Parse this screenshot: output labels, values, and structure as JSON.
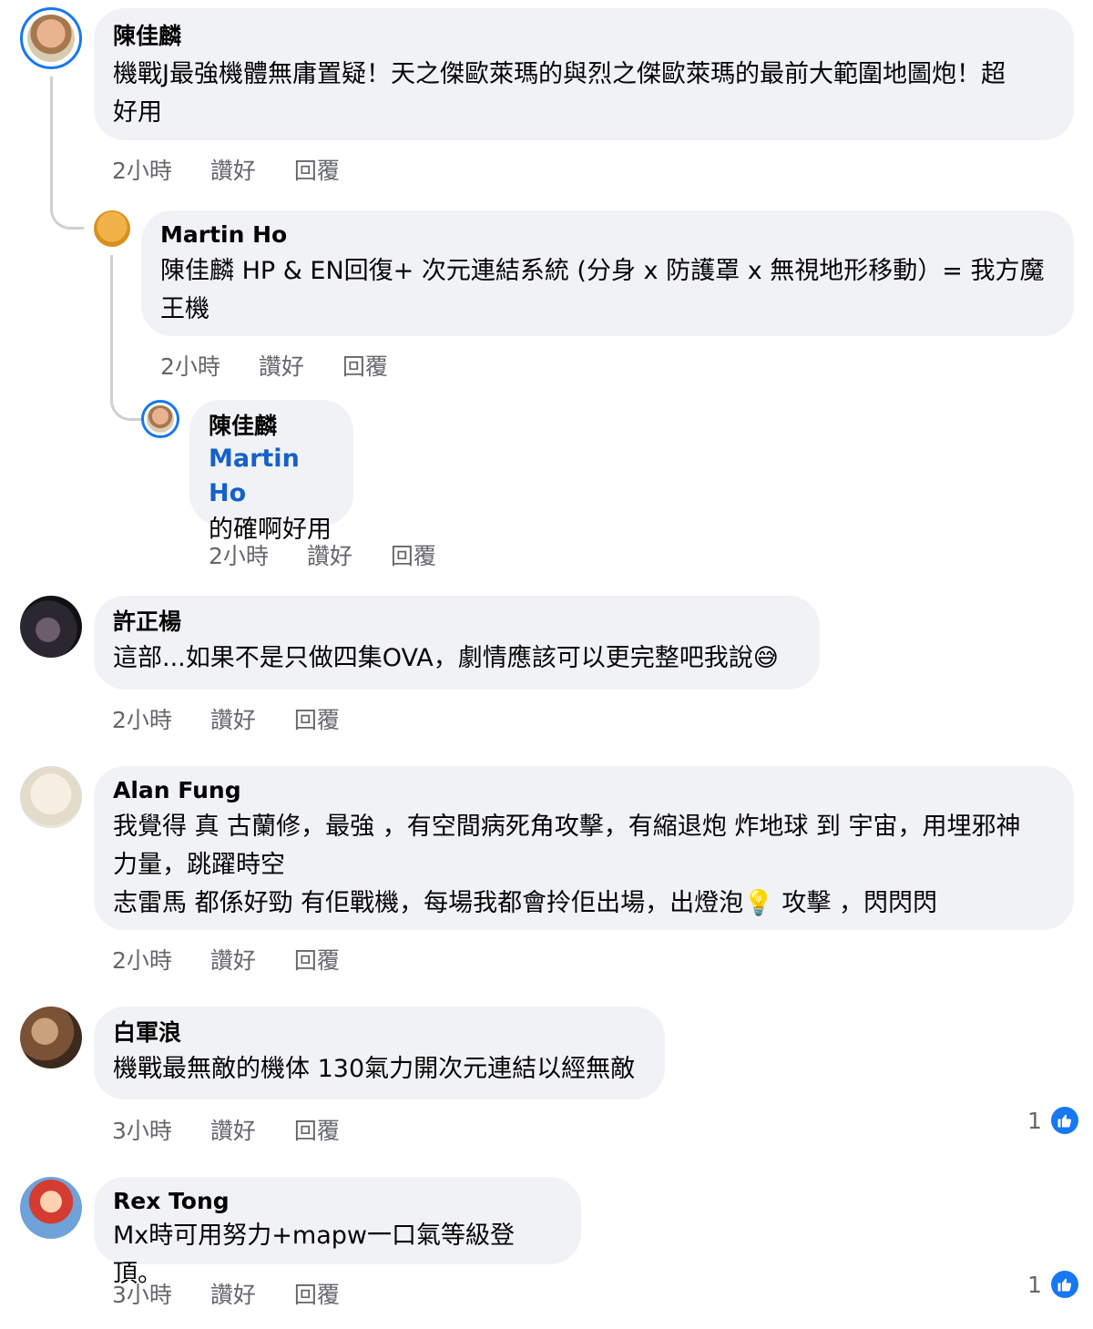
{
  "comments": [
    {
      "author": "陳佳麟",
      "text": "機戰J最強機體無庸置疑！天之傑歐萊瑪的與烈之傑歐萊瑪的最前大範圍地圖炮！超\n好用",
      "time": "2小時",
      "like": "讚好",
      "reply": "回覆"
    },
    {
      "author": "Martin Ho",
      "text": "陳佳麟 HP & EN回復+ 次元連結系統 (分身 x 防護罩 x 無視地形移動）= 我方魔\n王機",
      "time": "2小時",
      "like": "讚好",
      "reply": "回覆"
    },
    {
      "author": "陳佳麟",
      "mention": "Martin Ho",
      "text": "的確啊好用",
      "time": "2小時",
      "like": "讚好",
      "reply": "回覆"
    },
    {
      "author": "許正楊",
      "text": "這部...如果不是只做四集OVA，劇情應該可以更完整吧我說😅",
      "time": "2小時",
      "like": "讚好",
      "reply": "回覆"
    },
    {
      "author": "Alan Fung",
      "text": "我覺得 真 古蘭修，最強 ，有空間病死角攻擊，有縮退炮 炸地球 到 宇宙，用埋邪神\n力量，跳躍時空\n志雷馬 都係好勁 有佢戰機，每場我都會拎佢出場，出燈泡💡 攻擊 ，閃閃閃",
      "time": "2小時",
      "like": "讚好",
      "reply": "回覆"
    },
    {
      "author": "白軍浪",
      "text": "機戰最無敵的機体 130氣力開次元連結以經無敵",
      "time": "3小時",
      "like": "讚好",
      "reply": "回覆",
      "reactions": "1"
    },
    {
      "author": "Rex Tong",
      "text": "Mx時可用努力+mapw一口氣等級登頂。",
      "time": "3小時",
      "like": "讚好",
      "reply": "回覆",
      "reactions": "1"
    }
  ],
  "colors": {
    "accent": "#1877f2",
    "bubble": "#f0f2f5",
    "meta": "#65676b"
  },
  "icons": {
    "like": "like-thumb-icon"
  }
}
